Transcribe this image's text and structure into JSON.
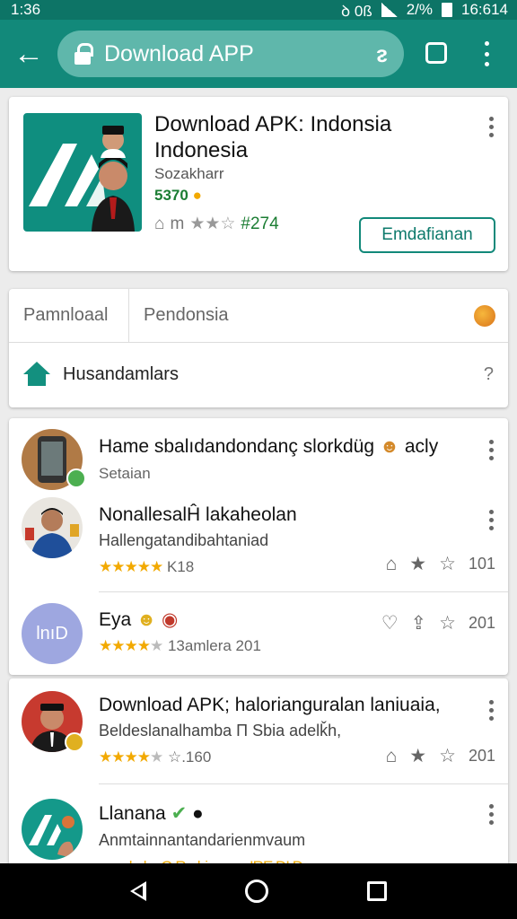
{
  "status_bar": {
    "time": "1:36",
    "indicators": "ꝺ 0ß",
    "battery_pct": "2/%",
    "clock": "16:614"
  },
  "toolbar": {
    "url_text": "Download APP",
    "search_glyph": "ᴤ"
  },
  "app": {
    "title": "Download APK: Indonsia Indonesia",
    "developer": "Sozakharr",
    "price": "5370",
    "rating_label": "m",
    "rating_count": "#274",
    "install_label": "Emdafianan"
  },
  "tabs": {
    "tab1": "Pamnloaal",
    "tab2": "Pendonsia"
  },
  "home_row": {
    "label": "Husandamlars"
  },
  "items": [
    {
      "title": "Hame sbalıdandondanç slorkdüg",
      "title_suffix": "acly",
      "subtitle": "Setaian"
    },
    {
      "title": "NonallesalĤ lakaheolan",
      "subtitle": "Hallengatandibahtaniad",
      "rating_text": "K18",
      "count": "101"
    },
    {
      "title": "Eya",
      "subtitle": "",
      "rating_text": "13amlera 201",
      "count": "201",
      "avatar_text": "lnıD"
    },
    {
      "title": "Download APK; halorianguralan laniuaia,",
      "subtitle": "Beldeslanalhamba Π Sbia adelǩh,",
      "rating_text": "☆.160",
      "count": "201"
    },
    {
      "title": "Llanana",
      "subtitle": "Anmtainnantandarienmvaum",
      "rating_text": "ımaekaku O.Rrahiamnm IRE DI D"
    }
  ],
  "colors": {
    "toolbar": "#12897a",
    "status": "#0d7466",
    "accent_green": "#1b7d33",
    "star": "#f2a900"
  }
}
